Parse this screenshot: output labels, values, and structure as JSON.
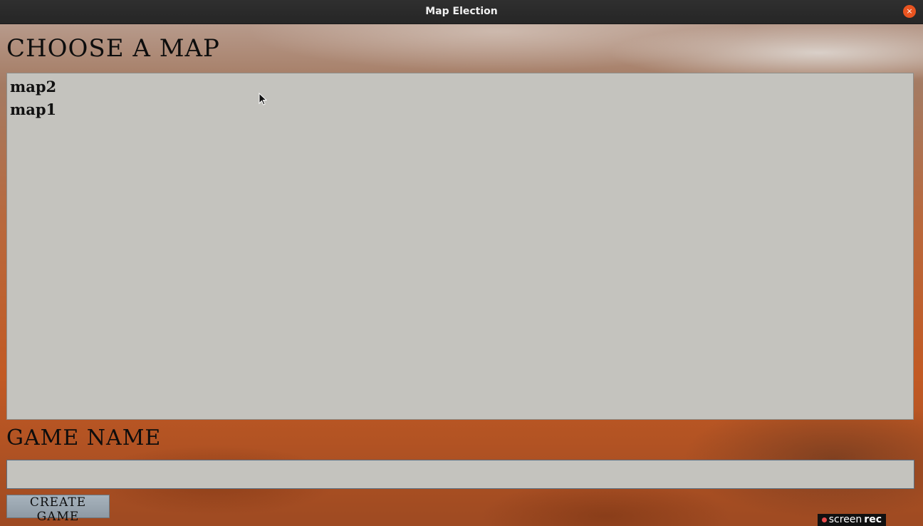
{
  "window": {
    "title": "Map Election",
    "close_icon": "×"
  },
  "choose_map": {
    "heading": "CHOOSE A MAP",
    "maps": [
      {
        "label": "map2"
      },
      {
        "label": "map1"
      }
    ]
  },
  "game_name": {
    "heading": "GAME NAME",
    "value": "",
    "placeholder": ""
  },
  "create_button": {
    "label": "CREATE GAME"
  },
  "watermark": {
    "text_light": "screen",
    "text_bold": "rec"
  },
  "colors": {
    "accent_close": "#e95420",
    "panel_bg": "#c4c3be",
    "button_bg": "#9ea9b3"
  }
}
